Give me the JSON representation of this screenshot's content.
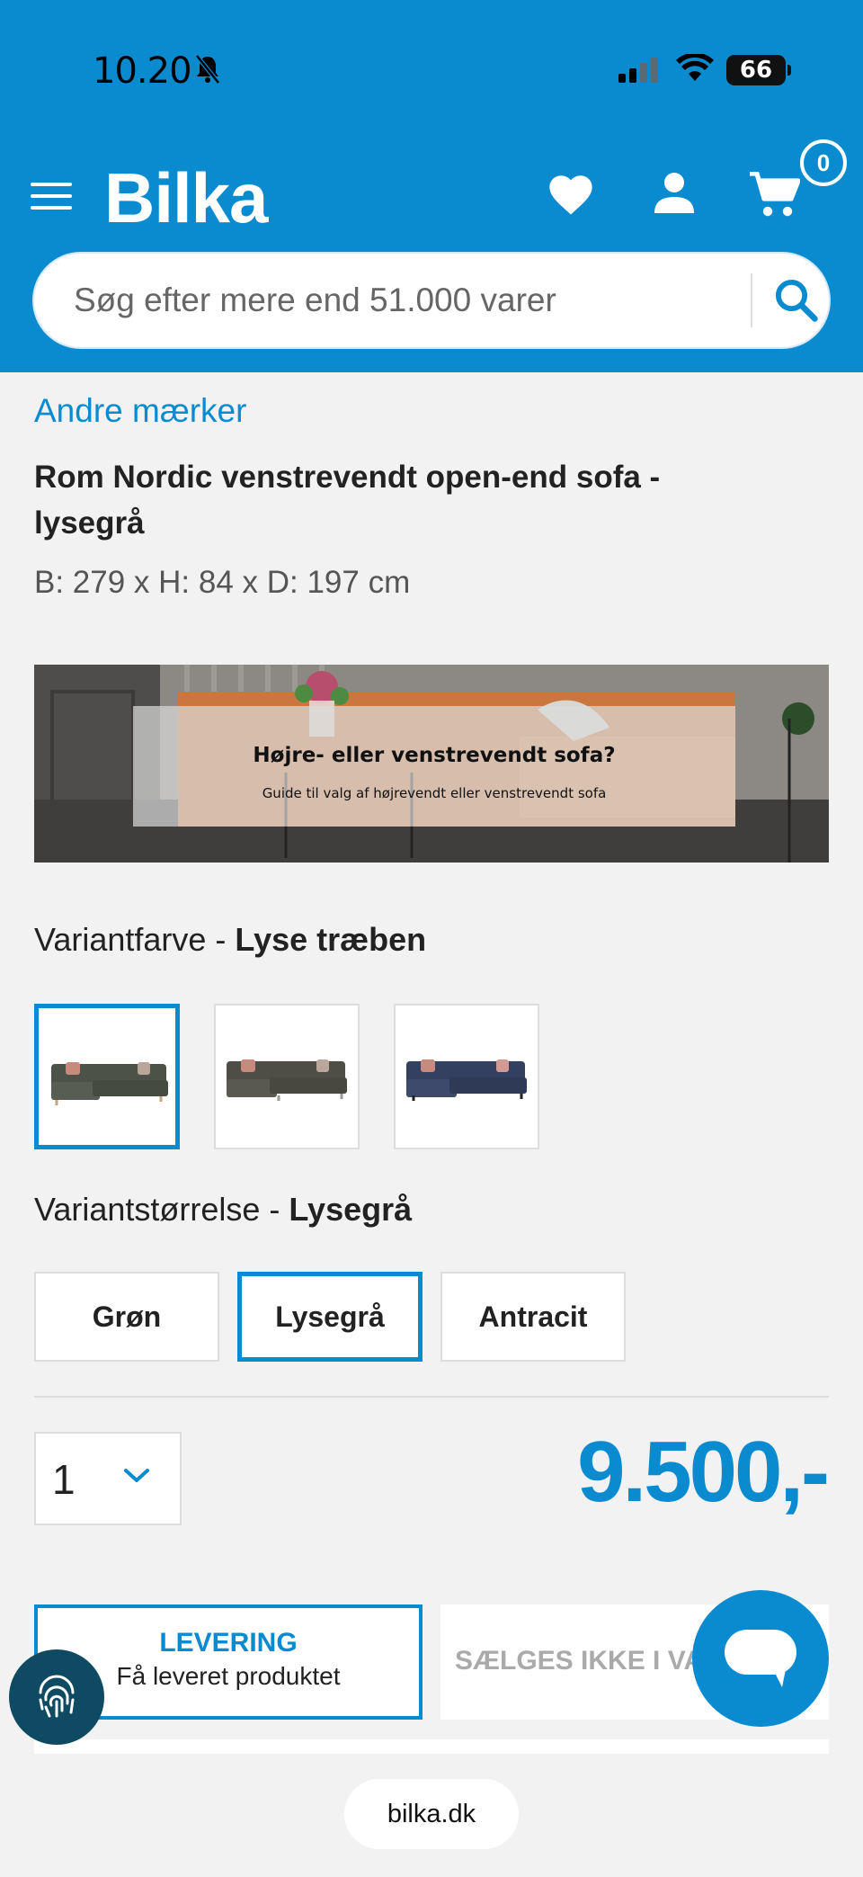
{
  "status_bar": {
    "time": "10.20",
    "battery": "66"
  },
  "header": {
    "logo": "Bilka",
    "cart_count": "0"
  },
  "search": {
    "placeholder": "Søg efter mere end 51.000 varer"
  },
  "product": {
    "brand": "Andre mærker",
    "title": "Rom Nordic venstrevendt open-end sofa - lysegrå",
    "dimensions": "B: 279 x H: 84 x D: 197 cm"
  },
  "banner": {
    "title": "Højre- eller venstrevendt sofa?",
    "subtitle": "Guide til valg af højrevendt eller venstrevendt sofa"
  },
  "variant_color": {
    "label": "Variantfarve - ",
    "selected": "Lyse træben",
    "swatches": [
      "green-sofa",
      "grey-sofa",
      "blue-sofa"
    ],
    "selected_index": 0
  },
  "variant_size": {
    "label": "Variantstørrelse - ",
    "selected": "Lysegrå",
    "options": [
      "Grøn",
      "Lysegrå",
      "Antracit"
    ],
    "selected_index": 1
  },
  "quantity": {
    "value": "1"
  },
  "price": "9.500,-",
  "delivery": {
    "title": "LEVERING",
    "subtitle": "Få leveret produktet"
  },
  "store": {
    "text": "SÆLGES IKKE I VA"
  },
  "browser": {
    "url": "bilka.dk"
  },
  "colors": {
    "brand_blue": "#0a8bd0",
    "background": "#f2f2f2"
  }
}
